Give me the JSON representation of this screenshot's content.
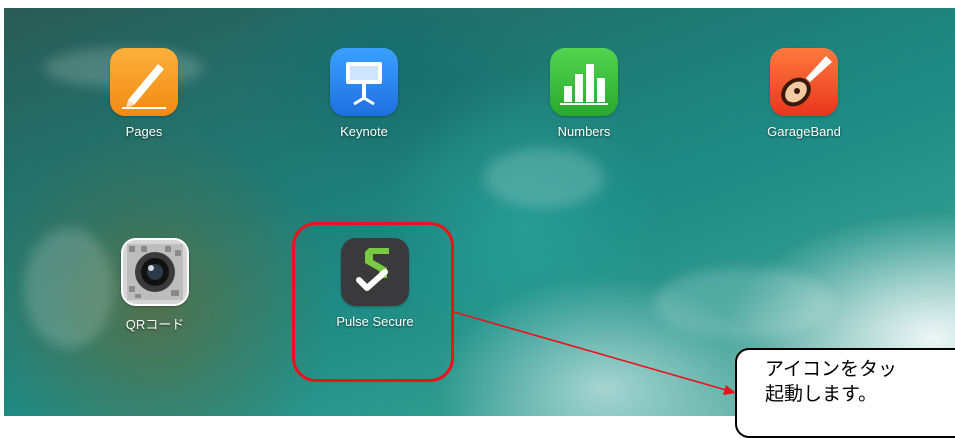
{
  "home_screen": {
    "apps": [
      {
        "label": "Pages",
        "icon": "pages-pen-icon"
      },
      {
        "label": "Keynote",
        "icon": "keynote-podium-icon"
      },
      {
        "label": "Numbers",
        "icon": "numbers-bar-chart-icon"
      },
      {
        "label": "GarageBand",
        "icon": "garageband-guitar-icon"
      },
      {
        "label": "QRコード",
        "icon": "qr-camera-icon"
      },
      {
        "label": "Pulse Secure",
        "icon": "pulse-secure-icon"
      }
    ]
  },
  "callout": {
    "line1": "アイコンをタッ",
    "line2": "起動します。"
  },
  "colors": {
    "highlight": "#e8141b",
    "pages": "#f59a1b",
    "keynote": "#2a8cf5",
    "numbers": "#3cc43c",
    "garageband": "#f0562b",
    "pulse": "#3a3a3c"
  }
}
